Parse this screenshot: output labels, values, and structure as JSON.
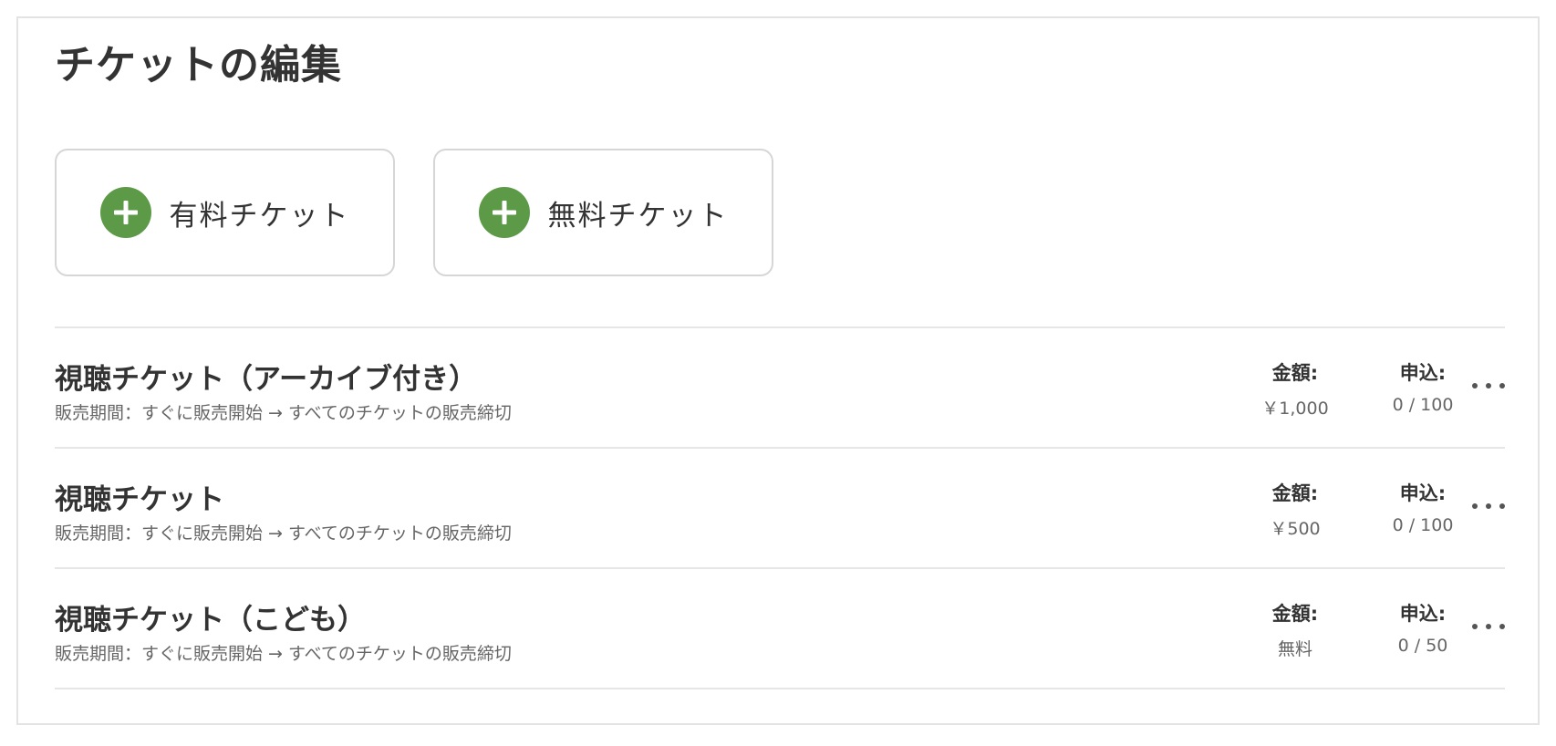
{
  "page": {
    "title": "チケットの編集"
  },
  "actions": {
    "paid_label": "有料チケット",
    "free_label": "無料チケット"
  },
  "labels": {
    "price": "金額:",
    "apply": "申込:"
  },
  "tickets": [
    {
      "name": "視聴チケット（アーカイブ付き）",
      "period": "販売期間：すぐに販売開始 → すべてのチケットの販売締切",
      "price": "￥1,000",
      "applications": "0 / 100"
    },
    {
      "name": "視聴チケット",
      "period": "販売期間：すぐに販売開始 → すべてのチケットの販売締切",
      "price": "￥500",
      "applications": "0 / 100"
    },
    {
      "name": "視聴チケット（こども）",
      "period": "販売期間：すぐに販売開始 → すべてのチケットの販売締切",
      "price": "無料",
      "applications": "0 / 50"
    }
  ],
  "icons": {
    "add": "plus-circle-icon",
    "more": "more-horizontal-icon"
  },
  "colors": {
    "accent": "#5d9a48",
    "text": "#333333",
    "muted": "#666666",
    "border": "#e6e6e6"
  }
}
